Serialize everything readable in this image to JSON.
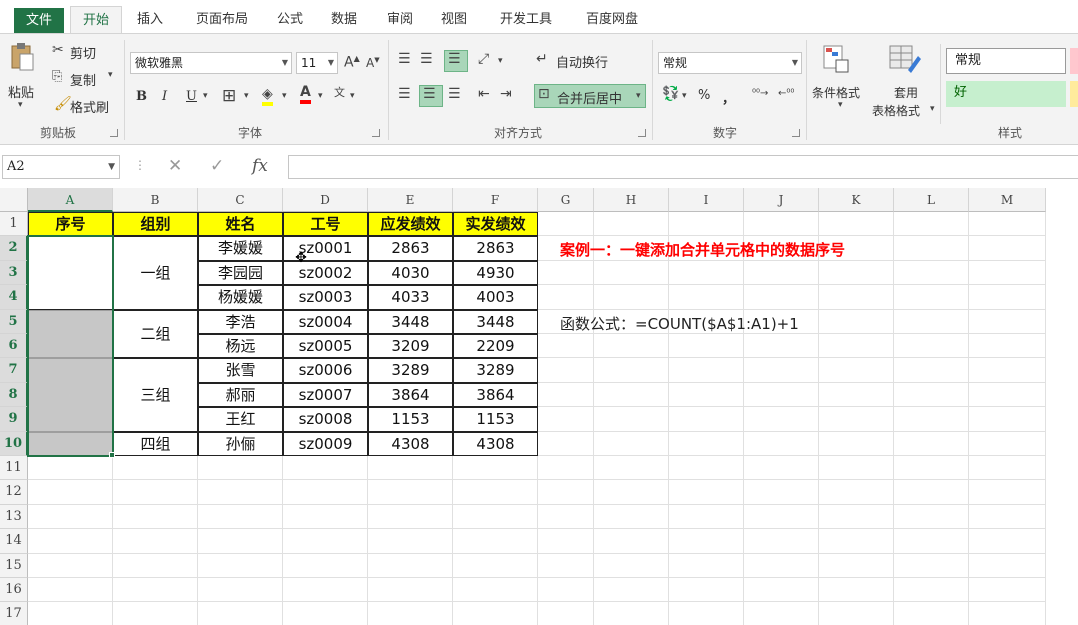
{
  "ribbon_tabs": [
    "文件",
    "开始",
    "插入",
    "页面布局",
    "公式",
    "数据",
    "审阅",
    "视图",
    "开发工具",
    "百度网盘"
  ],
  "clipboard": {
    "paste": "粘贴",
    "cut": "剪切",
    "copy": "复制",
    "format_painter": "格式刷",
    "label": "剪贴板"
  },
  "font": {
    "name": "微软雅黑",
    "size": "11",
    "bold": "B",
    "italic": "I",
    "underline": "U",
    "label": "字体"
  },
  "alignment": {
    "wrap_text": "自动换行",
    "merge_center": "合并后居中",
    "label": "对齐方式"
  },
  "number": {
    "format": "常规",
    "percent": "%",
    "comma": "，",
    "label": "数字"
  },
  "styles": {
    "conditional_format": "条件格式",
    "table_format_1": "套用",
    "table_format_2": "表格格式",
    "normal": "常规",
    "good": "好",
    "label": "样式"
  },
  "formula_bar": {
    "name_box": "A2",
    "fx": "fx",
    "value": ""
  },
  "columns": [
    "A",
    "B",
    "C",
    "D",
    "E",
    "F",
    "G",
    "H",
    "I",
    "J",
    "K",
    "L",
    "M"
  ],
  "rows": [
    "1",
    "2",
    "3",
    "4",
    "5",
    "6",
    "7",
    "8",
    "9",
    "10",
    "11",
    "12",
    "13",
    "14",
    "15",
    "16",
    "17"
  ],
  "table": {
    "headers": [
      "序号",
      "组别",
      "姓名",
      "工号",
      "应发绩效",
      "实发绩效"
    ],
    "groups": [
      "一组",
      "二组",
      "三组",
      "四组"
    ],
    "records": [
      [
        "李媛媛",
        "sz0001",
        "2863",
        "2863"
      ],
      [
        "李园园",
        "sz0002",
        "4030",
        "4930"
      ],
      [
        "杨媛媛",
        "sz0003",
        "4033",
        "4003"
      ],
      [
        "李浩",
        "sz0004",
        "3448",
        "3448"
      ],
      [
        "杨远",
        "sz0005",
        "3209",
        "2209"
      ],
      [
        "张雪",
        "sz0006",
        "3289",
        "3289"
      ],
      [
        "郝丽",
        "sz0007",
        "3864",
        "3864"
      ],
      [
        "王红",
        "sz0008",
        "1153",
        "1153"
      ],
      [
        "孙俪",
        "sz0009",
        "4308",
        "4308"
      ]
    ]
  },
  "notes": {
    "case_title": "案例一：一键添加合并单元格中的数据序号",
    "formula": "函数公式：=COUNT($A$1:A1)+1"
  },
  "colors": {
    "accent": "#217346",
    "header_fill": "#ffff00",
    "note_red": "#ff0000",
    "selection_gray": "#c7c7c7"
  }
}
